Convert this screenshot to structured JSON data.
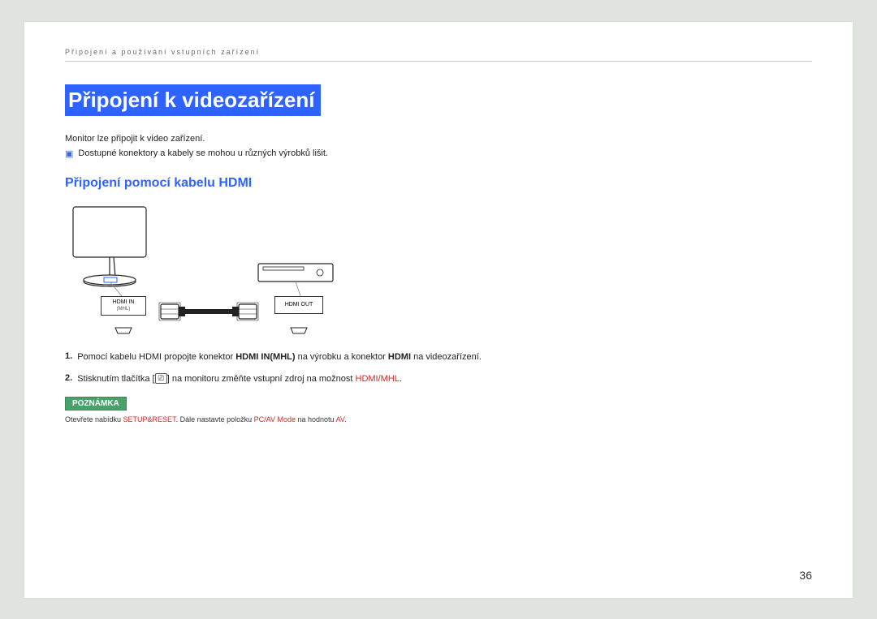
{
  "breadcrumb": "Připojení a používání vstupních zařízení",
  "h1": "Připojení k videozařízení",
  "intro": "Monitor lze připojit k video zařízení.",
  "bullet": "Dostupné konektory a kabely se mohou u různých výrobků lišit.",
  "h2": "Připojení pomocí kabelu HDMI",
  "diagram": {
    "port_in_line1": "HDMI IN",
    "port_in_line2": "(MHL)",
    "port_out": "HDMI OUT"
  },
  "steps": [
    {
      "num": "1.",
      "pre": "Pomocí kabelu HDMI propojte konektor ",
      "b1": "HDMI IN(MHL)",
      "mid": " na výrobku a konektor ",
      "b2": "HDMI",
      "post": " na videozařízení."
    },
    {
      "num": "2.",
      "pre": "Stisknutím tlačítka [",
      "icon": "⎚",
      "mid": "] na monitoru změňte vstupní zdroj na možnost ",
      "hl": "HDMI/MHL",
      "post": "."
    }
  ],
  "note_label": "POZNÁMKA",
  "note": {
    "t1": "Otevřete nabídku ",
    "r1": "SETUP&RESET",
    "t2": ". Dále nastavte položku ",
    "r2": "PC/AV Mode",
    "t3": " na hodnotu ",
    "r3": "AV",
    "t4": "."
  },
  "page_number": "36"
}
